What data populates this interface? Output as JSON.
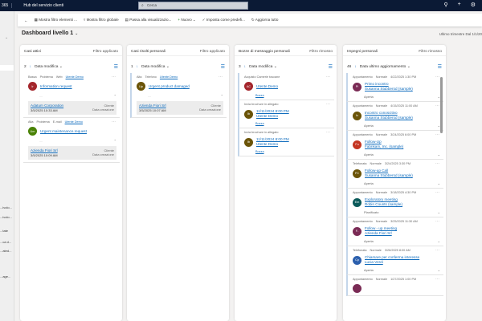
{
  "topbar": {
    "logo": "365",
    "app": "Hub del servizio clienti",
    "search_placeholder": "Cerca"
  },
  "toolbar": {
    "items": [
      "Mostra filtro elementi ...",
      "Mostra filtro globale",
      "Passa alla visualizzazio...",
      "Nuovo",
      "Imposta come predefi...",
      "Aggiorna tutto"
    ]
  },
  "sidebar": {
    "items": [
      "...ivolo...",
      "...ivolo...",
      "...tate",
      "...ca d...",
      "...ated...",
      "...age..."
    ]
  },
  "page": {
    "title": "Dashboard livello 1",
    "range": "Ultimo trimestre Dal 1/1/20"
  },
  "columns": [
    {
      "title": "Casi attivi",
      "filter": "Filtro applicato",
      "count": "2",
      "sort": "Data modifica",
      "cards": [
        {
          "meta": [
            "Bassa",
            "Problema",
            "Web"
          ],
          "owner": "Utente Demo",
          "initials": "Ir",
          "color": "#a4262c",
          "title": "Information request",
          "account": "Adatum Corporation",
          "date": "3/5/2025 10:33 AM",
          "acc_label": "Cliente",
          "date_label": "Data creazione"
        },
        {
          "meta": [
            "Alta",
            "Problema",
            "E-mail"
          ],
          "owner": "Utente Demo",
          "initials": "Um",
          "color": "#498205",
          "title": "Urgent maintenance request",
          "account": "Azienda Fiori Srl",
          "date": "3/5/2025 10:09 AM",
          "acc_label": "Cliente",
          "date_label": "Data creazione"
        }
      ]
    },
    {
      "title": "Casi risolti personali",
      "filter": "Filtro applicato",
      "count": "1",
      "sort": "Data modifica",
      "cards": [
        {
          "meta": [
            "Alta",
            "Telefono"
          ],
          "owner": "Utente Demo",
          "initials": "Up",
          "color": "#6b5408",
          "title": "Urgent product damaged",
          "account": "Azienda Fiori Srl",
          "date": "3/5/2025 10:07 AM",
          "acc_label": "Cliente",
          "date_label": "Data creazione"
        }
      ]
    },
    {
      "title": "Bozze di messaggio personali",
      "filter": "Filtro rimosso",
      "count": "3",
      "sort": "Data modifica",
      "cards": [
        {
          "subject": "Acquisto Camerie toscane",
          "initials": "AC",
          "color": "#a4262c",
          "lines": [
            "Utente Demo"
          ],
          "status": "Bozza"
        },
        {
          "subject": "Invia brochure in allegato",
          "initials": "Ib",
          "color": "#6b5408",
          "lines": [
            "11/11/2024 8:00 PM",
            "Utente Demo"
          ],
          "status": "Bozza"
        },
        {
          "subject": "Invia brochure in allegato",
          "initials": "Ib",
          "color": "#6b5408",
          "lines": [
            "11/11/2024 8:00 PM",
            "Utente Demo"
          ],
          "status": "Bozza"
        }
      ]
    },
    {
      "title": "Impegni personali",
      "filter": "Filtro rimosso",
      "count": "46",
      "sort": "Data ultimo aggiornamento",
      "cards": [
        {
          "meta": [
            "Appuntamento",
            "Normale",
            "4/22/2025 1:30 PM"
          ],
          "initials": "Pi",
          "color": "#7a2b55",
          "lines": [
            "Primo incontro",
            "Susanna Stubberod (sample)"
          ],
          "status": "Aperta"
        },
        {
          "meta": [
            "Appuntamento",
            "Normale",
            "4/15/2025 11:00 AM"
          ],
          "initials": "Ic",
          "color": "#6b5408",
          "lines": [
            "Incontro conoscitivo",
            "Susanna Stubberod (sample)"
          ],
          "status": "Aperta"
        },
        {
          "meta": [
            "Appuntamento",
            "Normale",
            "3/24/2025 6:00 PM"
          ],
          "initials": "Fu",
          "color": "#c43522",
          "lines": [
            "Follow-Up",
            "Fabrikam, Inc. (sample)"
          ],
          "status": "Aperta"
        },
        {
          "meta": [
            "Telefonata",
            "Normale",
            "3/24/2025 3:30 PM"
          ],
          "initials": "FC",
          "color": "#6b5408",
          "lines": [
            "Follow-up Call",
            "Susanna Stubberod (sample)"
          ],
          "status": "Aperta"
        },
        {
          "meta": [
            "Appuntamento",
            "Normale",
            "3/18/2025 4:30 PM"
          ],
          "initials": "Em",
          "color": "#0b5a5a",
          "lines": [
            "Exploratory meeting",
            "Robin Counts (sample)"
          ],
          "status": "Pianificato"
        },
        {
          "meta": [
            "Appuntamento",
            "Normale",
            "3/25/2025 11:30 AM"
          ],
          "initials": "F-",
          "color": "#7a2b55",
          "lines": [
            "Follow - up meeting",
            "Azienda Fiori Srl"
          ],
          "status": "Aperta"
        },
        {
          "meta": [
            "Telefonata",
            "Normale",
            "3/26/2025 8:00 AM"
          ],
          "initials": "Cp",
          "color": "#2b5fad",
          "lines": [
            "Chiamare per conferma interesse",
            "Lucia Verdi"
          ],
          "status": "Aperta"
        },
        {
          "meta": [
            "Appuntamento",
            "Normale",
            "1/27/2025 1:00 PM"
          ],
          "initials": "",
          "color": "#7a2b55",
          "lines": [],
          "status": ""
        }
      ]
    }
  ]
}
